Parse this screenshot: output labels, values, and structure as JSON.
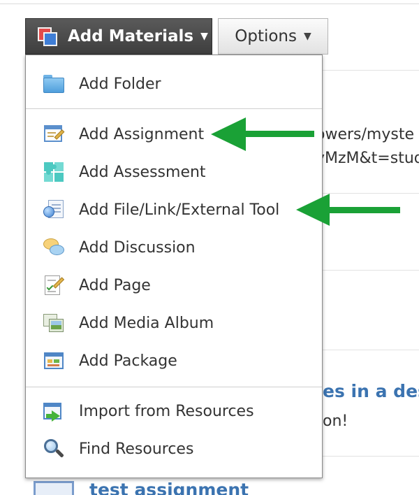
{
  "toolbar": {
    "add_materials_label": "Add Materials",
    "options_label": "Options"
  },
  "menu": {
    "items": [
      {
        "label": "Add Folder",
        "icon": "folder-icon"
      },
      {
        "label": "Add Assignment",
        "icon": "assignment-icon"
      },
      {
        "label": "Add Assessment",
        "icon": "assessment-icon"
      },
      {
        "label": "Add File/Link/External Tool",
        "icon": "file-link-icon"
      },
      {
        "label": "Add Discussion",
        "icon": "discussion-icon"
      },
      {
        "label": "Add Page",
        "icon": "page-icon"
      },
      {
        "label": "Add Media Album",
        "icon": "media-album-icon"
      },
      {
        "label": "Add Package",
        "icon": "package-icon"
      },
      {
        "label": "Import from Resources",
        "icon": "import-icon"
      },
      {
        "label": "Find Resources",
        "icon": "find-icon"
      }
    ]
  },
  "background": {
    "url_text_1": "owers/myste",
    "url_text_2": "yMzM&t=stud",
    "link_title": "es in a des",
    "snippet": "on!",
    "bottom_title": "test assignment"
  },
  "annotation": {
    "arrow_color": "#1aa136"
  }
}
